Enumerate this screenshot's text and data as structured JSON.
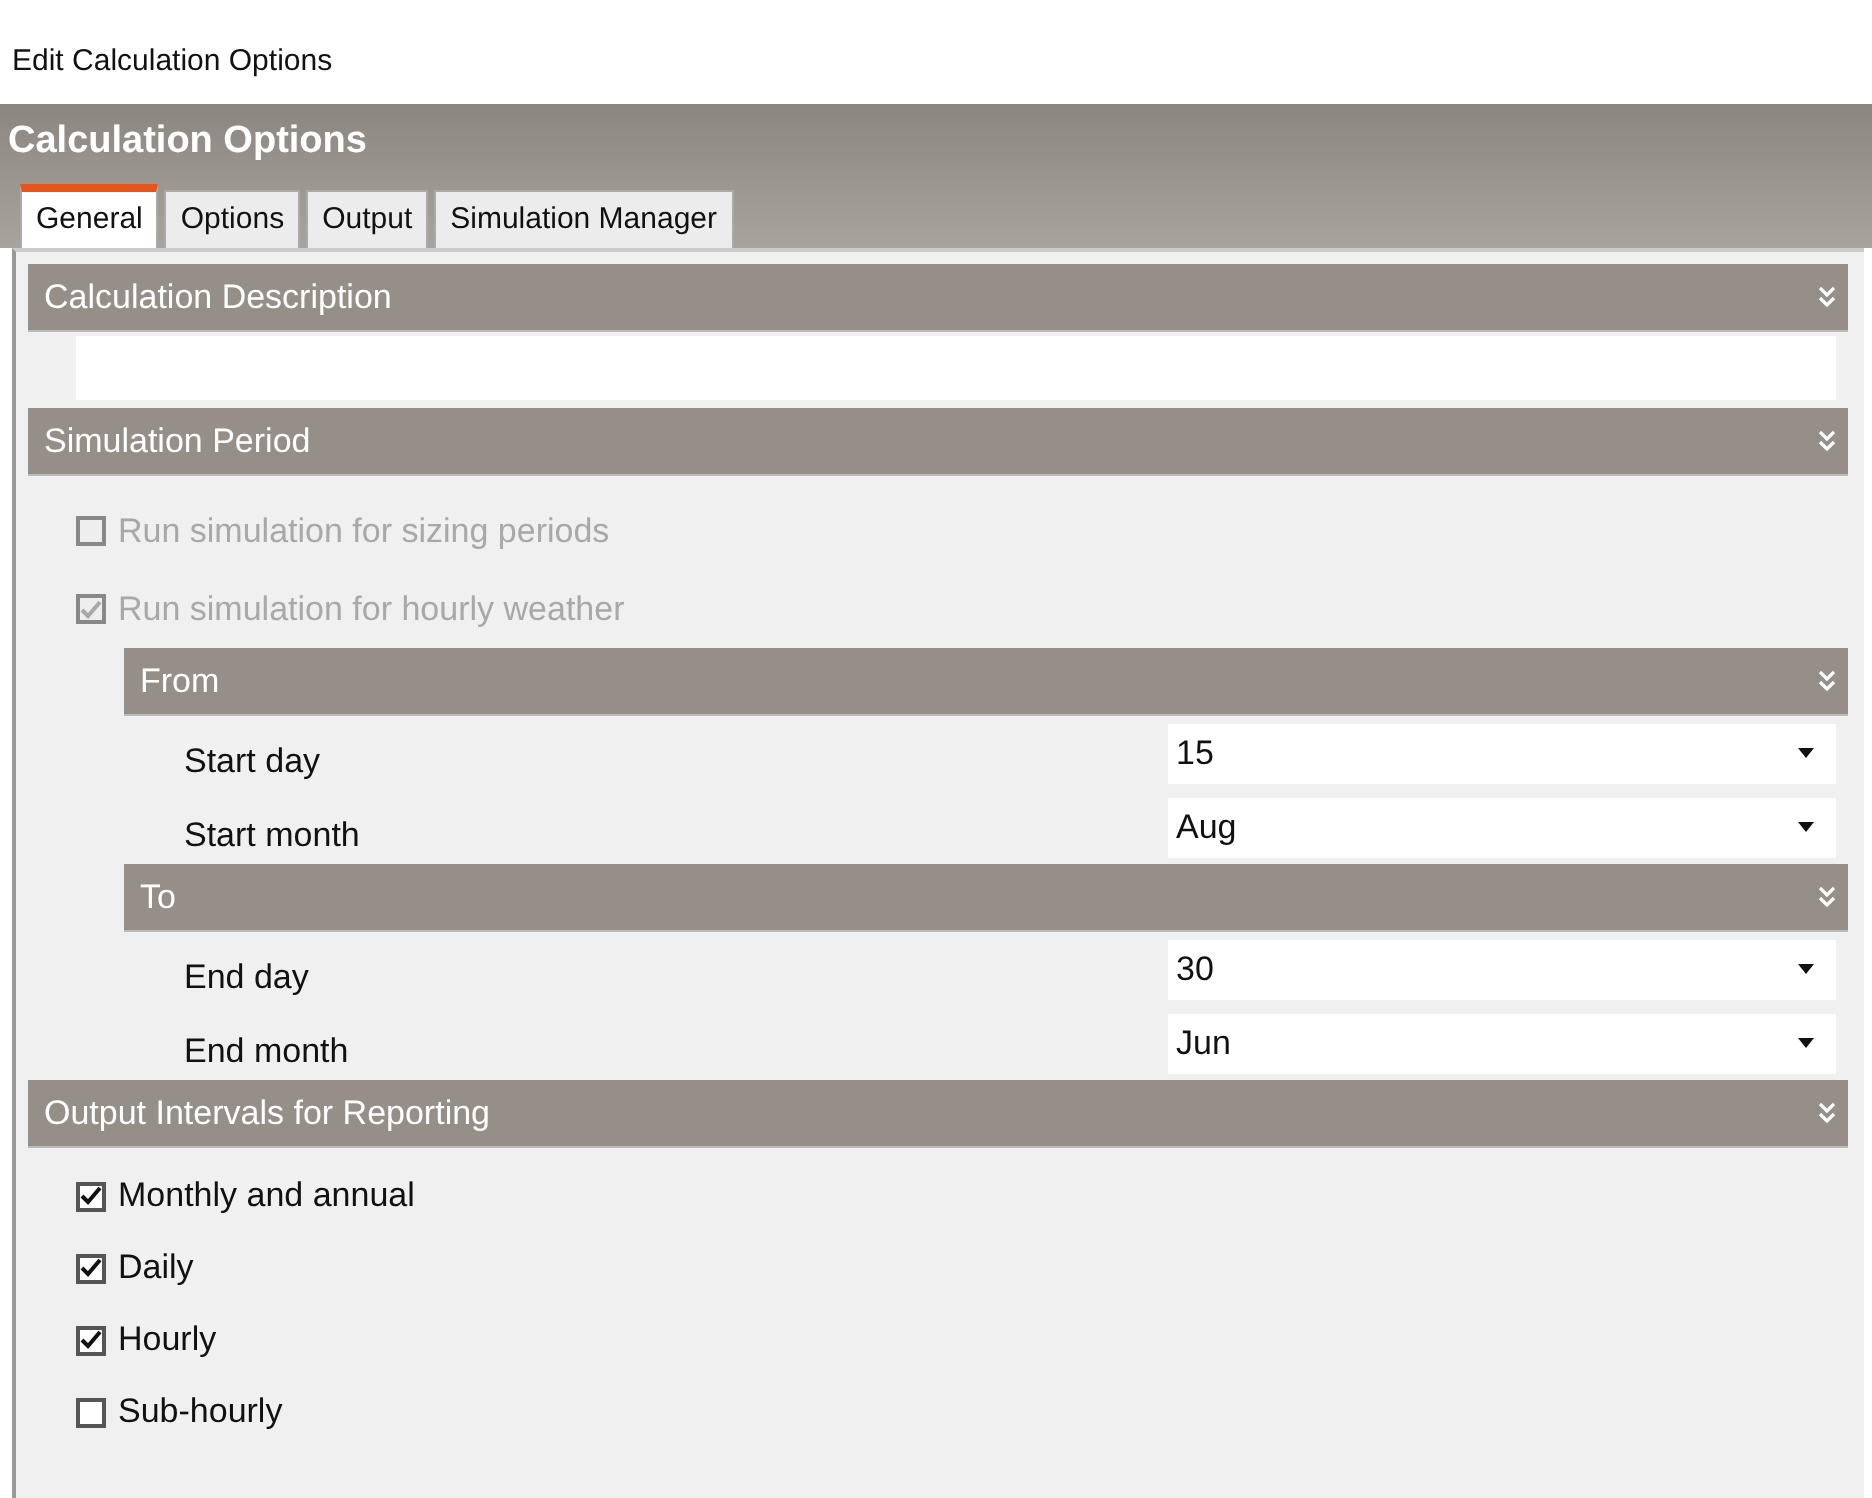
{
  "window": {
    "title": "Edit Calculation Options"
  },
  "panel": {
    "title": "Calculation Options",
    "tabs": [
      {
        "label": "General",
        "selected": true
      },
      {
        "label": "Options",
        "selected": false
      },
      {
        "label": "Output",
        "selected": false
      },
      {
        "label": "Simulation Manager",
        "selected": false
      }
    ],
    "sections": [
      {
        "kind": "textbox",
        "title": "Calculation Description"
      },
      {
        "kind": "period",
        "title": "Simulation Period",
        "checkboxes": [
          {
            "label": "Run simulation for sizing periods",
            "checked": false,
            "disabled": true
          },
          {
            "label": "Run simulation for hourly weather",
            "checked": true,
            "disabled": true
          }
        ],
        "groups": [
          {
            "title": "From",
            "fields": [
              {
                "label": "Start day",
                "value": "15"
              },
              {
                "label": "Start month",
                "value": "Aug"
              }
            ]
          },
          {
            "title": "To",
            "fields": [
              {
                "label": "End day",
                "value": "30"
              },
              {
                "label": "End month",
                "value": "Jun"
              }
            ]
          }
        ]
      },
      {
        "kind": "checklist",
        "title": "Output Intervals for Reporting",
        "checkboxes": [
          {
            "label": "Monthly and annual",
            "checked": true,
            "disabled": false
          },
          {
            "label": "Daily",
            "checked": true,
            "disabled": false
          },
          {
            "label": "Hourly",
            "checked": true,
            "disabled": false
          },
          {
            "label": "Sub-hourly",
            "checked": false,
            "disabled": false
          }
        ]
      }
    ]
  }
}
